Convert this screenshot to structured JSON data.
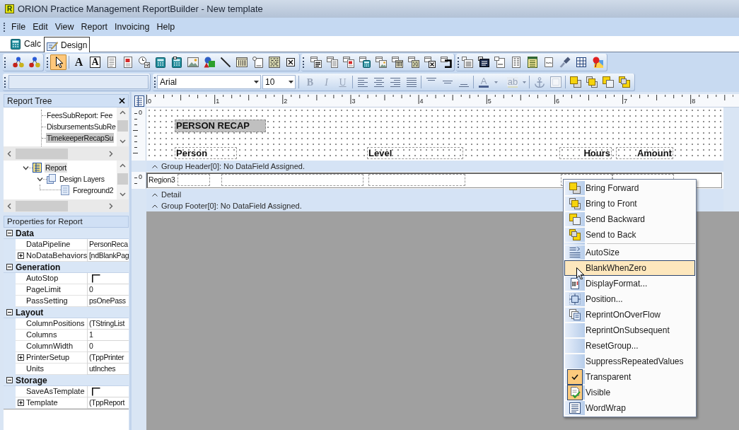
{
  "window": {
    "icon_letter": "R",
    "title": "ORION Practice Management ReportBuilder - New template"
  },
  "menu_bar": [
    "File",
    "Edit",
    "View",
    "Report",
    "Invoicing",
    "Help"
  ],
  "view_tabs": [
    {
      "label": "Calc",
      "kind": "calc",
      "selected": false
    },
    {
      "label": "Design",
      "kind": "design",
      "selected": true
    }
  ],
  "component_tools": [
    {
      "kind": "pointer",
      "selected": true
    },
    {
      "kind": "label",
      "glyph": "A",
      "selected": false
    },
    {
      "kind": "dblabel",
      "glyph": "A",
      "selected": false
    },
    {
      "kind": "memo",
      "selected": false
    },
    {
      "kind": "richtext",
      "selected": false
    },
    {
      "kind": "variable",
      "selected": false
    },
    {
      "kind": "calc",
      "selected": false
    },
    {
      "kind": "dbcalc",
      "selected": false
    },
    {
      "kind": "image",
      "selected": false
    },
    {
      "kind": "shape",
      "selected": false
    },
    {
      "kind": "line",
      "selected": false
    },
    {
      "kind": "barcode",
      "selected": false
    },
    {
      "kind": "region",
      "selected": false
    },
    {
      "kind": "matrix",
      "selected": false
    },
    {
      "kind": "checkbox",
      "selected": false
    }
  ],
  "font": {
    "name": "Arial",
    "size": "10"
  },
  "format_buttons": [
    {
      "kind": "bold",
      "label": "B",
      "disabled": true
    },
    {
      "kind": "italic",
      "label": "I",
      "disabled": true
    },
    {
      "kind": "underline",
      "label": "U",
      "disabled": true
    }
  ],
  "color_buttons": [
    {
      "kind": "font",
      "label": "A",
      "disabled": true
    },
    {
      "kind": "highlight",
      "label": "ab",
      "disabled": true
    }
  ],
  "report_tree": {
    "title": "Report Tree",
    "components": [
      {
        "label": "FeesSubReport: Fee",
        "selected": false
      },
      {
        "label": "DisbursementsSubRe",
        "selected": false
      },
      {
        "label": "TimekeeperRecapSu",
        "selected": true
      }
    ],
    "layers": [
      {
        "label": "Report",
        "kind": "report",
        "selected": true,
        "expanded": true,
        "children": [
          {
            "label": "Design Layers",
            "kind": "layers",
            "selected": false,
            "expanded": true,
            "children": [
              {
                "label": "Foreground2",
                "kind": "layer",
                "selected": false
              }
            ]
          }
        ]
      }
    ]
  },
  "properties": {
    "title": "Properties for Report",
    "categories": [
      {
        "label": "Data",
        "expanded": true,
        "rows": [
          {
            "name": "DataPipeline",
            "kind": "text",
            "value": "PersonReca"
          },
          {
            "name": "NoDataBehaviors",
            "kind": "set",
            "expanded": false,
            "value": "[ndBlankPag"
          }
        ]
      },
      {
        "label": "Generation",
        "expanded": true,
        "rows": [
          {
            "name": "AutoStop",
            "kind": "check",
            "checked": false
          },
          {
            "name": "PageLimit",
            "kind": "text",
            "value": "0"
          },
          {
            "name": "PassSetting",
            "kind": "text",
            "value": "psOnePass"
          }
        ]
      },
      {
        "label": "Layout",
        "expanded": true,
        "rows": [
          {
            "name": "ColumnPositions",
            "kind": "text",
            "value": "(TStringList"
          },
          {
            "name": "Columns",
            "kind": "text",
            "value": "1"
          },
          {
            "name": "ColumnWidth",
            "kind": "text",
            "value": "0"
          },
          {
            "name": "PrinterSetup",
            "kind": "set",
            "expanded": false,
            "value": "(TppPrinter"
          },
          {
            "name": "Units",
            "kind": "text",
            "value": "utInches"
          }
        ]
      },
      {
        "label": "Storage",
        "expanded": true,
        "rows": [
          {
            "name": "SaveAsTemplate",
            "kind": "check",
            "checked": false
          },
          {
            "name": "Template",
            "kind": "set",
            "expanded": false,
            "value": "(TppReport"
          }
        ]
      }
    ]
  },
  "design": {
    "ruler_labels": [
      "0",
      "1",
      "2",
      "3",
      "4",
      "5",
      "6",
      "7",
      "8"
    ],
    "sections": [
      {
        "kind": "band",
        "ruler_label": "0",
        "title": "PERSON RECAP",
        "column_labels": [
          "Person",
          "Level",
          "Hours",
          "Amount"
        ]
      },
      {
        "kind": "divider",
        "label": "Group Header[0]: No DataField Assigned."
      },
      {
        "kind": "group",
        "ruler_label": "0",
        "region": "Region3"
      },
      {
        "kind": "divider",
        "label": "Detail"
      },
      {
        "kind": "divider",
        "label": "Group Footer[0]: No DataField Assigned."
      }
    ]
  },
  "context_menu": {
    "sections": [
      {
        "items": [
          {
            "label": "Bring Forward",
            "kind": "bringforward",
            "checked": false,
            "selected": false
          },
          {
            "label": "Bring to Front",
            "kind": "bringtofront",
            "checked": false,
            "selected": false
          },
          {
            "label": "Send Backward",
            "kind": "sendbackward",
            "checked": false,
            "selected": false
          },
          {
            "label": "Send to Back",
            "kind": "sendtoback",
            "checked": false,
            "selected": false
          }
        ]
      },
      {
        "items": [
          {
            "label": "AutoSize",
            "kind": "autosize",
            "checked": false,
            "selected": false
          },
          {
            "label": "BlankWhenZero",
            "kind": "plain",
            "checked": false,
            "selected": true
          },
          {
            "label": "DisplayFormat...",
            "kind": "displayformat",
            "checked": false,
            "selected": false
          },
          {
            "label": "Position...",
            "kind": "position",
            "checked": false,
            "selected": false
          },
          {
            "label": "ReprintOnOverFlow",
            "kind": "reprint",
            "checked": false,
            "selected": false
          },
          {
            "label": "ReprintOnSubsequent",
            "kind": "plain",
            "checked": false,
            "selected": false
          },
          {
            "label": "ResetGroup...",
            "kind": "plain",
            "checked": false,
            "selected": false
          },
          {
            "label": "SuppressRepeatedValues",
            "kind": "plain",
            "checked": false,
            "selected": false
          },
          {
            "label": "Transparent",
            "kind": "plain",
            "checked": true,
            "selected": false
          },
          {
            "label": "Visible",
            "kind": "visible",
            "checked": true,
            "selected": false
          },
          {
            "label": "WordWrap",
            "kind": "wordwrap",
            "checked": false,
            "selected": false
          }
        ]
      }
    ]
  }
}
